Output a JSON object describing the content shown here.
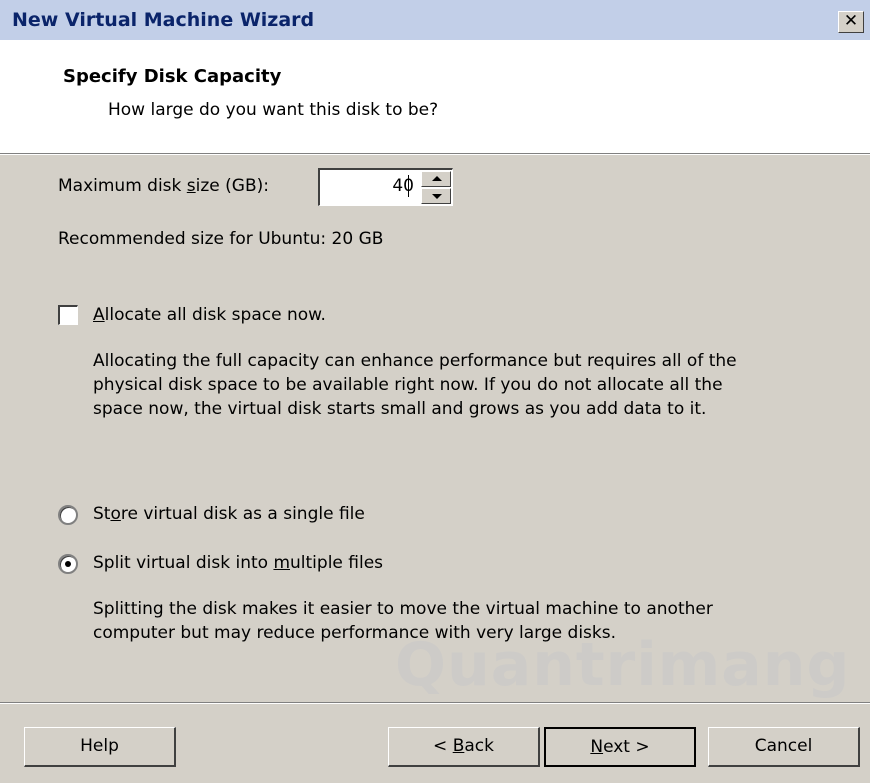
{
  "window": {
    "title": "New Virtual Machine Wizard"
  },
  "header": {
    "title": "Specify Disk Capacity",
    "subtitle": "How large do you want this disk to be?"
  },
  "disk": {
    "size_label_prefix": "Maximum disk ",
    "size_label_accel": "s",
    "size_label_suffix": "ize (GB):",
    "size_value": "40",
    "recommended": "Recommended size for Ubuntu: 20 GB"
  },
  "allocate": {
    "checked": false,
    "label_accel": "A",
    "label_rest": "llocate all disk space now.",
    "description": [
      "Allocating the full capacity can enhance performance but requires all of the",
      "physical disk space to be available right now. If you do not allocate all the",
      "space now, the virtual disk starts small and grows as you add data to it."
    ]
  },
  "storage": {
    "single_prefix": "St",
    "single_accel": "o",
    "single_suffix": "re virtual disk as a single file",
    "multi_prefix": "Split virtual disk into ",
    "multi_accel": "m",
    "multi_suffix": "ultiple files",
    "selected": "multiple",
    "description": [
      "Splitting the disk makes it easier to move the virtual machine to another",
      "computer but may reduce performance with very large disks."
    ]
  },
  "buttons": {
    "help": "Help",
    "back_prefix": "< ",
    "back_accel": "B",
    "back_suffix": "ack",
    "next_accel": "N",
    "next_suffix": "ext >",
    "cancel": "Cancel"
  },
  "watermark": "Quantrimang",
  "icons": {
    "close": "close-icon",
    "spin_up": "arrow-up-icon",
    "spin_down": "arrow-down-icon"
  }
}
